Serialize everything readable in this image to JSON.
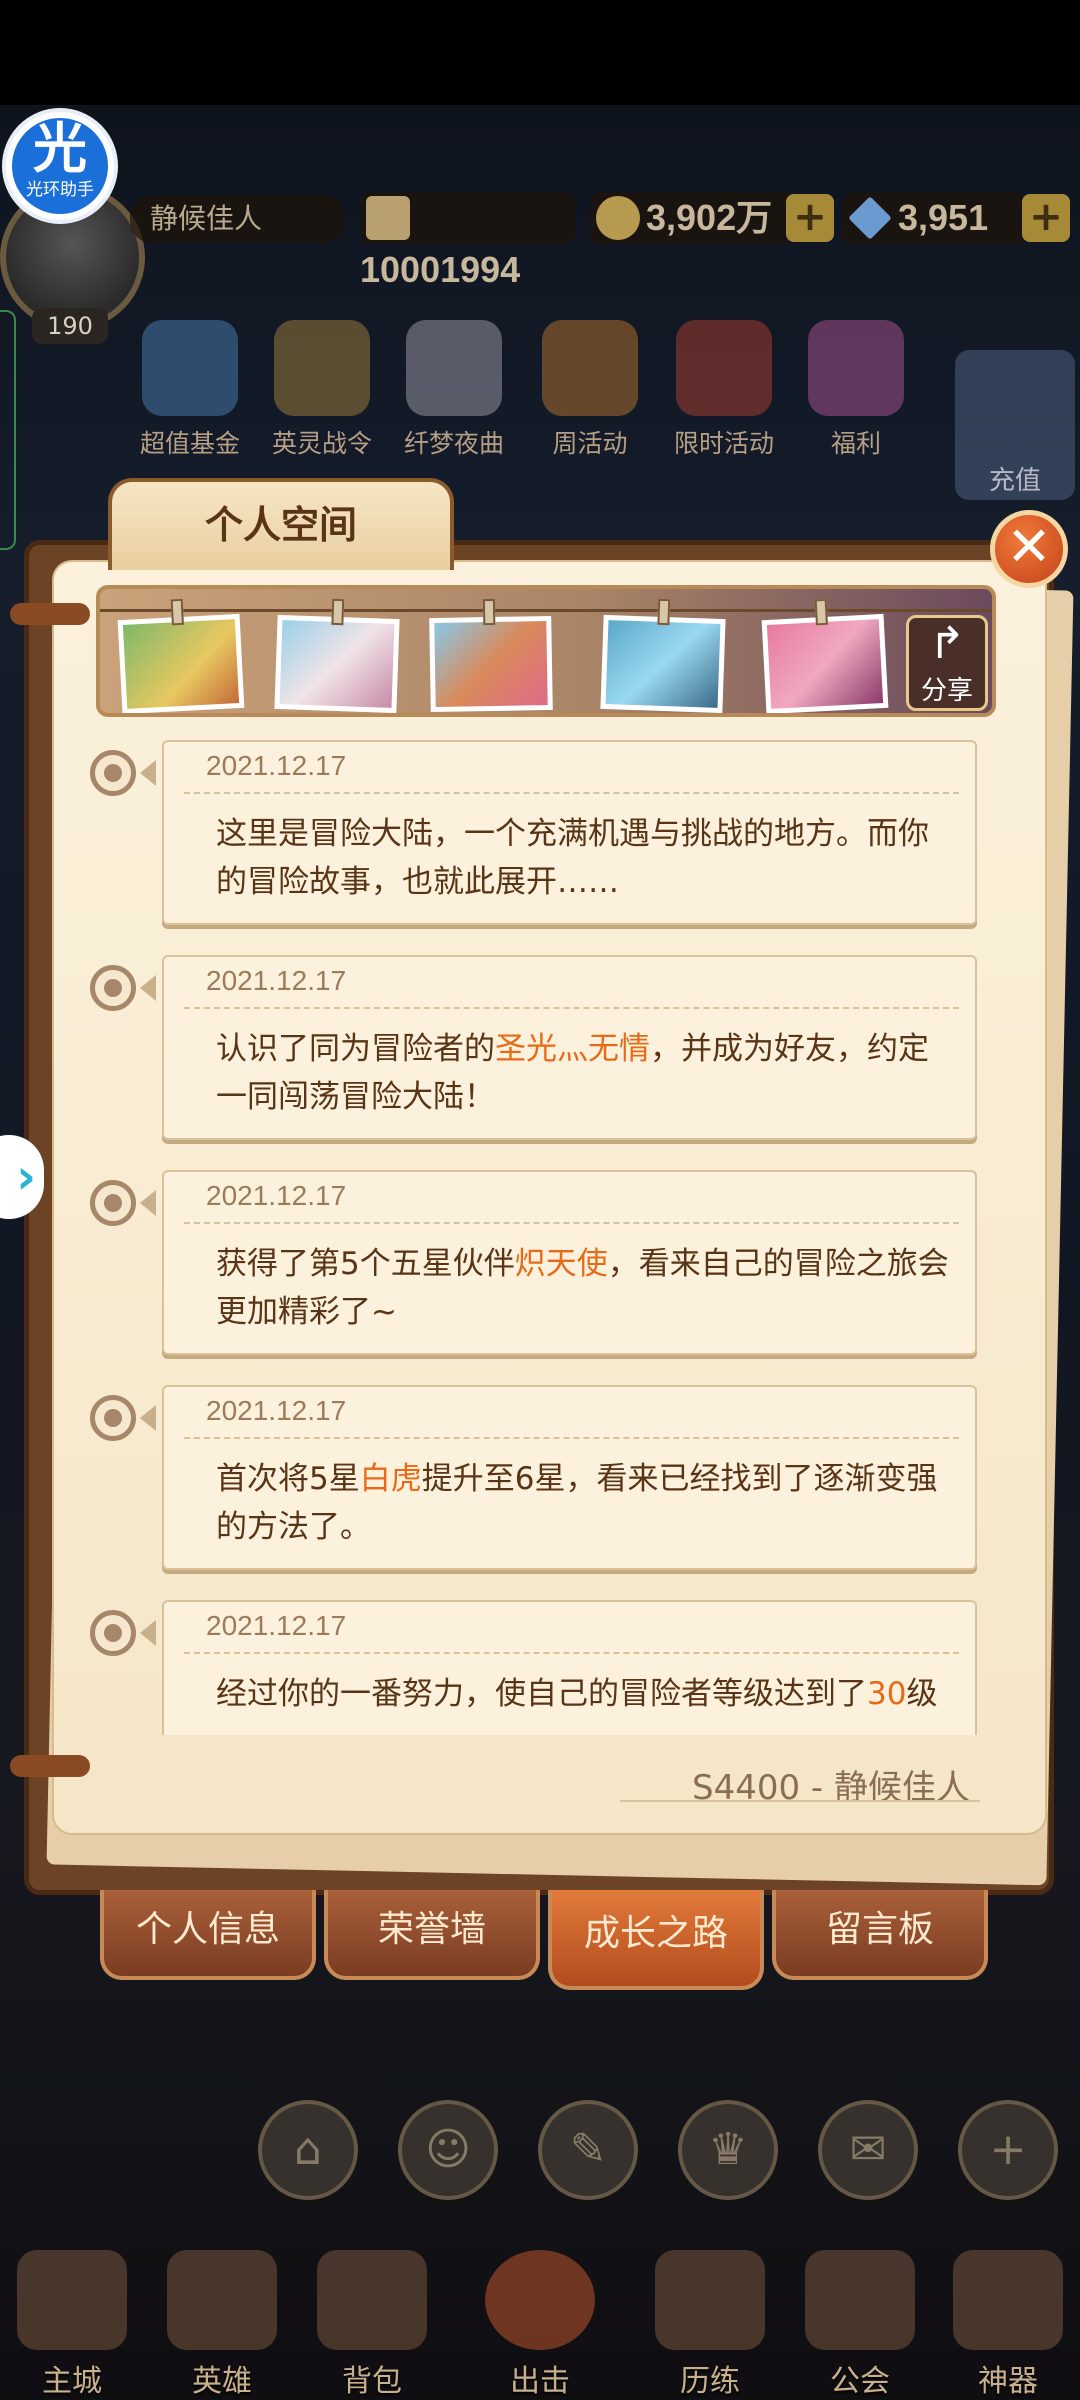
{
  "helper_badge": {
    "glyph": "光",
    "label": "光环助手"
  },
  "player": {
    "name": "静候佳人",
    "level": "190"
  },
  "resources": {
    "power": "10001994",
    "gold": "3,902万",
    "diamond": "3,951"
  },
  "features": [
    {
      "label": "超值基金",
      "icon": "fund-icon"
    },
    {
      "label": "英灵战令",
      "icon": "battle-pass-icon"
    },
    {
      "label": "纤梦夜曲",
      "icon": "event-character-icon"
    },
    {
      "label": "周活动",
      "icon": "weekly-horn-icon"
    },
    {
      "label": "限时活动",
      "icon": "limited-event-icon"
    },
    {
      "label": "福利",
      "icon": "gift-box-icon"
    }
  ],
  "recharge_label": "充值",
  "panel": {
    "title": "个人空间",
    "close_label": "✕",
    "share_label": "分享",
    "signature": "S4400 - 静候佳人"
  },
  "timeline": [
    {
      "date": "2021.12.17",
      "parts": [
        {
          "text": "这里是冒险大陆，一个充满机遇与挑战的地方。而你的冒险故事，也就此展开……",
          "hl": false
        }
      ]
    },
    {
      "date": "2021.12.17",
      "parts": [
        {
          "text": "认识了同为冒险者的",
          "hl": false
        },
        {
          "text": "圣光灬无情",
          "hl": true
        },
        {
          "text": "，并成为好友，约定一同闯荡冒险大陆！",
          "hl": false
        }
      ]
    },
    {
      "date": "2021.12.17",
      "parts": [
        {
          "text": "获得了第5个五星伙伴",
          "hl": false
        },
        {
          "text": "炽天使",
          "hl": true
        },
        {
          "text": "，看来自己的冒险之旅会更加精彩了~",
          "hl": false
        }
      ]
    },
    {
      "date": "2021.12.17",
      "parts": [
        {
          "text": "首次将5星",
          "hl": false
        },
        {
          "text": "白虎",
          "hl": true
        },
        {
          "text": "提升至6星，看来已经找到了逐渐变强的方法了。",
          "hl": false
        }
      ]
    },
    {
      "date": "2021.12.17",
      "parts": [
        {
          "text": "经过你的一番努力，使自己的冒险者等级达到了",
          "hl": false
        },
        {
          "text": "30",
          "hl": true
        },
        {
          "text": "级",
          "hl": false
        }
      ]
    }
  ],
  "tabs": [
    {
      "label": "个人信息",
      "active": false
    },
    {
      "label": "荣誉墙",
      "active": false
    },
    {
      "label": "成长之路",
      "active": true
    },
    {
      "label": "留言板",
      "active": false
    }
  ],
  "dock_icons": [
    "home-icon",
    "friends-icon",
    "notes-icon",
    "trophy-icon",
    "mail-icon",
    "plus-icon"
  ],
  "nav": [
    {
      "label": "主城",
      "icon": "castle-icon"
    },
    {
      "label": "英雄",
      "icon": "hero-icon"
    },
    {
      "label": "背包",
      "icon": "backpack-icon"
    },
    {
      "label": "出击",
      "icon": "crossed-swords-icon"
    },
    {
      "label": "历练",
      "icon": "training-icon"
    },
    {
      "label": "公会",
      "icon": "guild-icon"
    },
    {
      "label": "神器",
      "icon": "artifact-icon"
    }
  ],
  "colors": {
    "highlight": "#e96a16",
    "paper": "#fbf1dc",
    "frame": "#6d4326",
    "active_tab": "#e27a3a"
  }
}
